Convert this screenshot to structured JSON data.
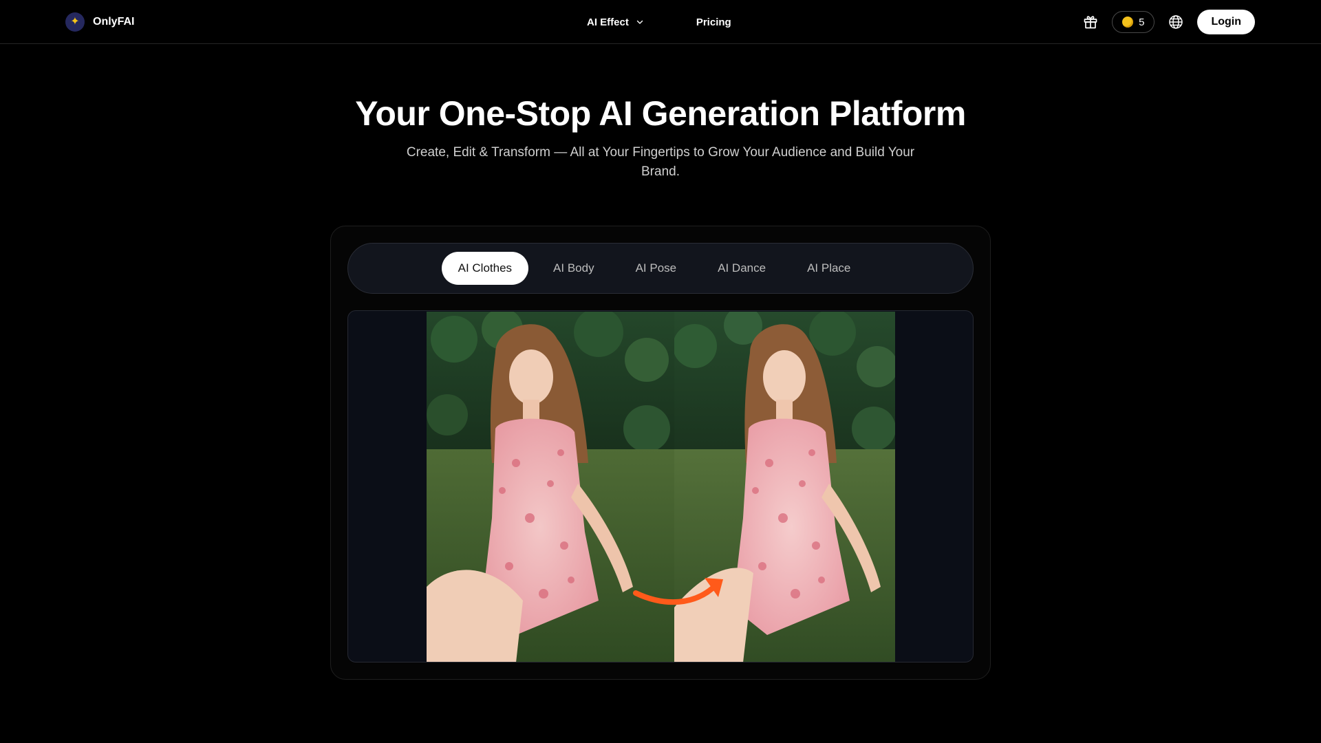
{
  "brand": {
    "name": "OnlyFAI",
    "logo_icon": "sparkle-icon"
  },
  "nav": {
    "items": [
      {
        "label": "AI Effect",
        "has_dropdown": true
      },
      {
        "label": "Pricing",
        "has_dropdown": false
      }
    ]
  },
  "toolbar": {
    "gift_icon": "gift-icon",
    "credits": "5",
    "language_icon": "globe-icon",
    "login_label": "Login"
  },
  "hero": {
    "title": "Your One-Stop AI Generation Platform",
    "subtitle": "Create, Edit & Transform — All at Your Fingertips to Grow Your Audience and Build Your Brand."
  },
  "tabs": {
    "items": [
      "AI Clothes",
      "AI Body",
      "AI Pose",
      "AI Dance",
      "AI Place"
    ],
    "active": "AI Clothes"
  },
  "colors": {
    "background": "#000000",
    "accent_arrow": "#ff5a1a",
    "coin": "#f4c21c"
  }
}
